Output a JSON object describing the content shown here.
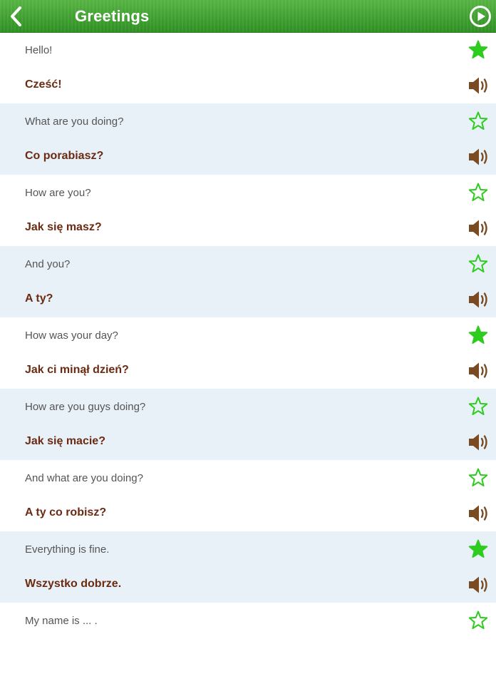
{
  "header": {
    "title": "Greetings",
    "back_icon": "chevron-left-icon",
    "play_icon": "play-circle-icon"
  },
  "colors": {
    "header_green": "#3fa02f",
    "star_green": "#2ecc1f",
    "speaker_brown": "#7a4a22",
    "polish_text": "#6b2a12",
    "alt_row_bg": "#e9f1f8"
  },
  "phrases": [
    {
      "english": "Hello!",
      "polish": "Cześć!",
      "favorite": true
    },
    {
      "english": "What are you doing?",
      "polish": "Co porabiasz?",
      "favorite": false
    },
    {
      "english": "How are you?",
      "polish": "Jak się masz?",
      "favorite": false
    },
    {
      "english": "And you?",
      "polish": "A ty?",
      "favorite": false
    },
    {
      "english": "How was your day?",
      "polish": "Jak ci minął dzień?",
      "favorite": true
    },
    {
      "english": "How are you guys doing?",
      "polish": "Jak się macie?",
      "favorite": false
    },
    {
      "english": "And what are you doing?",
      "polish": "A ty co robisz?",
      "favorite": false
    },
    {
      "english": "Everything is fine.",
      "polish": "Wszystko dobrze.",
      "favorite": true
    },
    {
      "english": "My name is ... .",
      "polish": "",
      "favorite": false
    }
  ]
}
